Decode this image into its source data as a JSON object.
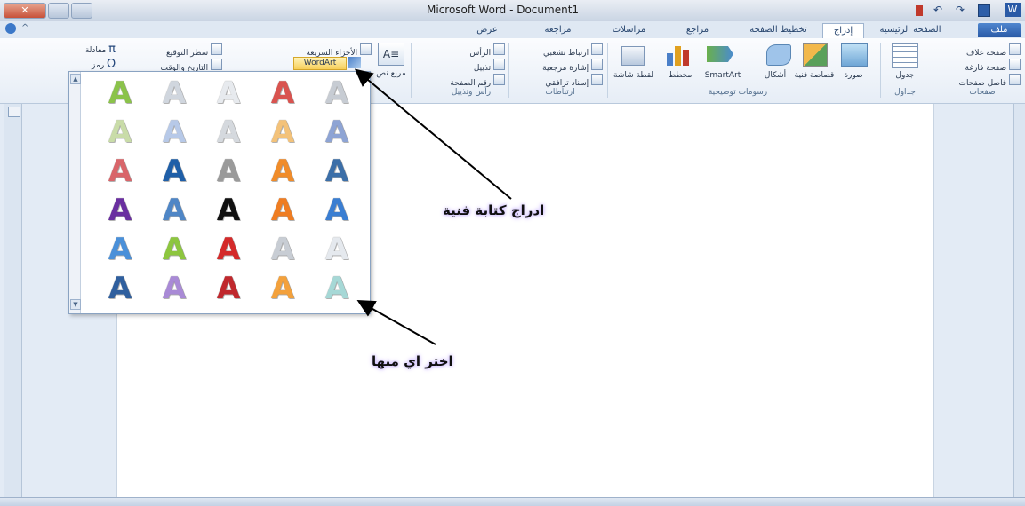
{
  "window": {
    "title": "Microsoft Word - Document1",
    "close_glyph": "✕"
  },
  "tabs": [
    {
      "label": "ملف",
      "type": "file"
    },
    {
      "label": "الصفحة الرئيسية",
      "type": "normal"
    },
    {
      "label": "إدراج",
      "type": "active"
    },
    {
      "label": "تخطيط الصفحة",
      "type": "normal"
    },
    {
      "label": "مراجع",
      "type": "normal"
    },
    {
      "label": "مراسلات",
      "type": "normal"
    },
    {
      "label": "مراجعة",
      "type": "normal"
    },
    {
      "label": "عرض",
      "type": "normal"
    }
  ],
  "ribbon": {
    "pages": {
      "group_label": "صفحات",
      "items": [
        "صفحة غلاف",
        "صفحة فارغة",
        "فاصل صفحات"
      ]
    },
    "tables": {
      "group_label": "جداول",
      "item": "جدول"
    },
    "illustrations": {
      "group_label": "رسومات توضيحية",
      "items": [
        "صورة",
        "قصاصة فنية",
        "أشكال",
        "SmartArt",
        "مخطط",
        "لقطة شاشة"
      ]
    },
    "links": {
      "group_label": "ارتباطات",
      "items": [
        "ارتباط تشعبي",
        "إشارة مرجعية",
        "إسناد ترافقي"
      ]
    },
    "header_footer": {
      "group_label": "رأس وتذييل",
      "items": [
        "الرأس",
        "تذييل",
        "رقم الصفحة"
      ]
    },
    "text": {
      "items": [
        "مربع نص",
        "الأجزاء السريعة",
        "WordArt",
        "سطر التوقيع",
        "التاريخ والوقت"
      ]
    },
    "symbols": {
      "items": [
        "معادلة",
        "رمز"
      ],
      "pi_glyph": "π",
      "omega_glyph": "Ω"
    }
  },
  "wordart_gallery": {
    "glyph": "A",
    "styles": [
      [
        "#8bc34a",
        "#d0d6de",
        "#e7eaee",
        "#d9534f",
        "#c7ccd3"
      ],
      [
        "#c9dca8",
        "#b7c9e8",
        "#d5d9de",
        "#f3c27a",
        "#8ea4d4"
      ],
      [
        "#d9656a",
        "#1f5fa8",
        "#9a9a9a",
        "#f08c2a",
        "#3c6fa8"
      ],
      [
        "#6a2fa0",
        "#4f86c6",
        "#111111",
        "#ef7d22",
        "#3a7ed2"
      ],
      [
        "#4a90d9",
        "#8dc63f",
        "#d42a2a",
        "#c8cdd4",
        "#e5e9ee"
      ],
      [
        "#2f5f9e",
        "#a98ad6",
        "#c0282d",
        "#f3a13c",
        "#a6d8d6"
      ]
    ]
  },
  "annotations": {
    "insert_wordart": "ادراج كتابة فنية",
    "choose_one": "اختر اي منها"
  },
  "colors": {
    "accent": "#2a5aa6",
    "callout_glow": "#c8b4ff"
  }
}
